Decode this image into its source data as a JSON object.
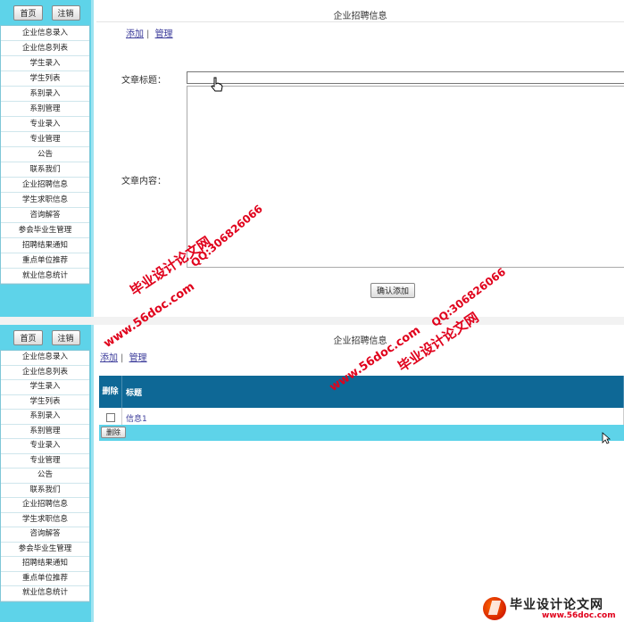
{
  "top": {
    "sidebar": {
      "home_btn": "首页",
      "logout_btn": "注销",
      "items": [
        "企业信息录入",
        "企业信息列表",
        "学生录入",
        "学生列表",
        "系别录入",
        "系别管理",
        "专业录入",
        "专业管理",
        "公告",
        "联系我们",
        "企业招聘信息",
        "学生求职信息",
        "咨询解答",
        "参会毕业生管理",
        "招聘结果通知",
        "重点单位推荐",
        "就业信息统计"
      ]
    },
    "main": {
      "title": "企业招聘信息",
      "add_link": "添加",
      "manage_link": "管理",
      "article_title_label": "文章标题：",
      "article_content_label": "文章内容：",
      "article_title_value": "",
      "article_content_value": "",
      "submit_label": "确认添加"
    }
  },
  "bottom": {
    "sidebar": {
      "home_btn": "首页",
      "logout_btn": "注销",
      "items": [
        "企业信息录入",
        "企业信息列表",
        "学生录入",
        "学生列表",
        "系别录入",
        "系别管理",
        "专业录入",
        "专业管理",
        "公告",
        "联系我们",
        "企业招聘信息",
        "学生求职信息",
        "咨询解答",
        "参会毕业生管理",
        "招聘结果通知",
        "重点单位推荐",
        "就业信息统计"
      ]
    },
    "main": {
      "title": "企业招聘信息",
      "add_link": "添加",
      "manage_link": "管理",
      "table": {
        "header_delete": "删除",
        "header_title": "标题",
        "rows": [
          {
            "title": "信息1"
          }
        ]
      },
      "delete_label": "删除"
    }
  },
  "watermarks": {
    "site_url": "www.56doc.com",
    "brand": "毕业设计论文网",
    "qq": "QQ:306826066"
  },
  "logo": {
    "title": "毕业设计论文网",
    "url": "www.56doc.com"
  },
  "colors": {
    "sidebar_bg": "#5ed3e9",
    "table_header_bg": "#0e6896",
    "watermark": "#e0001b"
  }
}
